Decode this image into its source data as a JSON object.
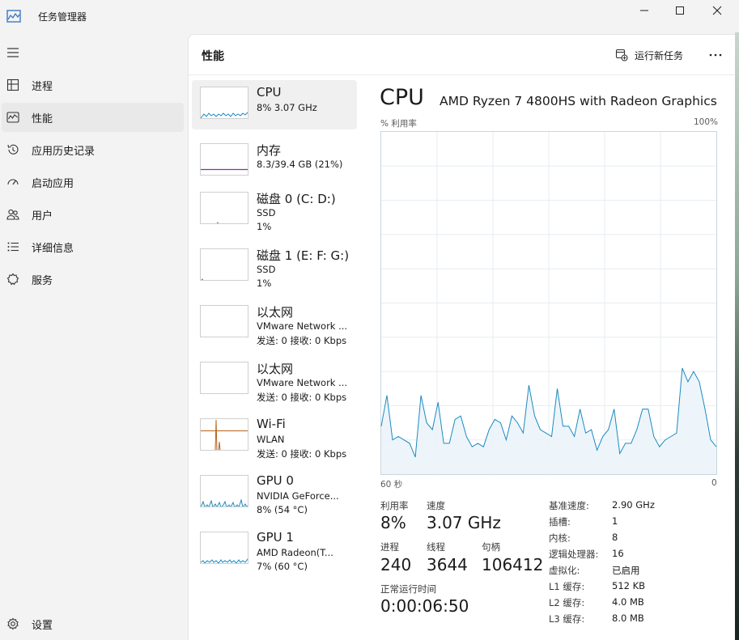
{
  "app": {
    "title": "任务管理器",
    "icon": "chart-icon"
  },
  "window_controls": {
    "minimize": "─",
    "maximize": "☐",
    "close": "✕"
  },
  "sidebar": {
    "items": [
      {
        "label": "进程",
        "icon": "processes-icon"
      },
      {
        "label": "性能",
        "icon": "performance-icon"
      },
      {
        "label": "应用历史记录",
        "icon": "app-history-icon"
      },
      {
        "label": "启动应用",
        "icon": "startup-icon"
      },
      {
        "label": "用户",
        "icon": "users-icon"
      },
      {
        "label": "详细信息",
        "icon": "details-icon"
      },
      {
        "label": "服务",
        "icon": "services-icon"
      }
    ],
    "settings_label": "设置",
    "active_index": 1
  },
  "header": {
    "title": "性能",
    "run_task_label": "运行新任务",
    "more": "···"
  },
  "devices": [
    {
      "name": "CPU",
      "line2": "8% 3.07 GHz",
      "line3": ""
    },
    {
      "name": "内存",
      "line2": "8.3/39.4 GB (21%)",
      "line3": ""
    },
    {
      "name": "磁盘 0 (C: D:)",
      "line2": "SSD",
      "line3": "1%"
    },
    {
      "name": "磁盘 1 (E: F: G:)",
      "line2": "SSD",
      "line3": "1%"
    },
    {
      "name": "以太网",
      "line2": "VMware Network ...",
      "line3": "发送: 0 接收: 0 Kbps"
    },
    {
      "name": "以太网",
      "line2": "VMware Network ...",
      "line3": "发送: 0 接收: 0 Kbps"
    },
    {
      "name": "Wi-Fi",
      "line2": "WLAN",
      "line3": "发送: 0 接收: 0 Kbps"
    },
    {
      "name": "GPU 0",
      "line2": "NVIDIA GeForce...",
      "line3": "8% (54 °C)"
    },
    {
      "name": "GPU 1",
      "line2": "AMD Radeon(T...",
      "line3": "7% (60 °C)"
    }
  ],
  "cpu": {
    "title": "CPU",
    "model": "AMD Ryzen 7 4800HS with Radeon Graphics",
    "axis_top_left": "% 利用率",
    "axis_top_right": "100%",
    "axis_bottom_left": "60 秒",
    "axis_bottom_right": "0",
    "stats": {
      "util_label": "利用率",
      "util": "8%",
      "speed_label": "速度",
      "speed": "3.07 GHz",
      "proc_label": "进程",
      "proc": "240",
      "threads_label": "线程",
      "threads": "3644",
      "handles_label": "句柄",
      "handles": "106412",
      "uptime_label": "正常运行时间",
      "uptime": "0:00:06:50"
    },
    "specs": [
      {
        "label": "基准速度:",
        "value": "2.90 GHz"
      },
      {
        "label": "插槽:",
        "value": "1"
      },
      {
        "label": "内核:",
        "value": "8"
      },
      {
        "label": "逻辑处理器:",
        "value": "16"
      },
      {
        "label": "虚拟化:",
        "value": "已启用"
      },
      {
        "label": "L1 缓存:",
        "value": "512 KB"
      },
      {
        "label": "L2 缓存:",
        "value": "4.0 MB"
      },
      {
        "label": "L3 缓存:",
        "value": "8.0 MB"
      }
    ]
  },
  "chart_data": {
    "type": "area",
    "ylabel": "% 利用率",
    "ylim": [
      0,
      100
    ],
    "xlim": [
      60,
      0
    ],
    "y_values": [
      14,
      23,
      10,
      11,
      10,
      9,
      5,
      23,
      15,
      13,
      21,
      9,
      9,
      16,
      17,
      11,
      8,
      9,
      8,
      13,
      16,
      15,
      10,
      17,
      15,
      12,
      26,
      17,
      13,
      12,
      11,
      25,
      14,
      14,
      11,
      19,
      12,
      13,
      7,
      11,
      13,
      19,
      6,
      9,
      9,
      13,
      19,
      19,
      11,
      8,
      10,
      11,
      12,
      31,
      27,
      30,
      27,
      19,
      10,
      8
    ],
    "accent": "#1b8ac1",
    "fill": "#eaf3f9",
    "grid": true
  }
}
